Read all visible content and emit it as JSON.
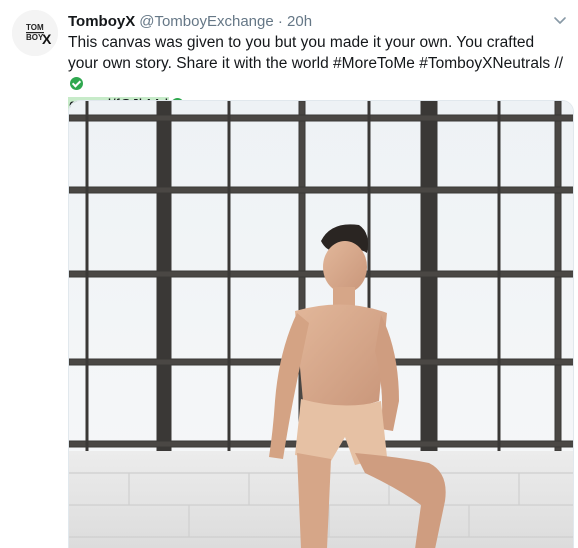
{
  "tweet": {
    "display_name": "TomboyX",
    "handle": "@TomboyExchange",
    "separator": "·",
    "timestamp": "20h",
    "avatar_text_top": "TOM",
    "avatar_text_bottom": "BOY",
    "avatar_mark": "X",
    "text_part1": "This canvas was given to you but you made it your own. You crafted your own story. Share it with the world ",
    "hashtag1": "#MoreToMe",
    "hashtag2": "#TomboyXNeutrals",
    "text_part2": " // ",
    "link": "goo.gl/fCJkMd"
  },
  "icons": {
    "caret": "chevron-down-icon",
    "verified": "check-circle-icon"
  },
  "colors": {
    "text": "#14171a",
    "muted": "#657786",
    "link": "#1b95e0",
    "check": "#2fa84f",
    "link_highlight": "#c7ebc9"
  }
}
